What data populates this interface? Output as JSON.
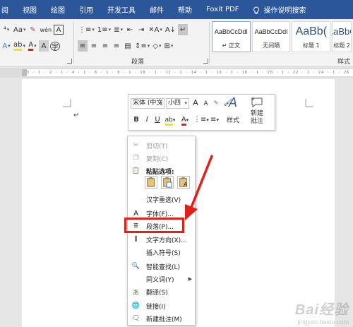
{
  "ribbon_tabs": [
    "阅",
    "视图",
    "绘图",
    "引用",
    "开发工具",
    "邮件",
    "帮助",
    "Foxit PDF"
  ],
  "tell_me": "操作说明搜索",
  "groups": {
    "paragraph": "段落",
    "styles": "样式"
  },
  "styles": [
    {
      "preview": "AaBbCcDdI",
      "name": "↵ 正文"
    },
    {
      "preview": "AaBbCcDdI",
      "name": "无间隔"
    },
    {
      "preview": "AaBb(",
      "name": "标题 1"
    },
    {
      "preview": "AaBbC",
      "name": "标题 2"
    }
  ],
  "font_row": {
    "aa_label": "Aa",
    "wen_label": "wén",
    "a_box": "A"
  },
  "ruler": {
    "numbers": "3 · 1 · 2 · 1 · 4 · 1 · 6 · 1 · 8 · 1 · 10 · 1 · 12 · 1 · 14 · 1 · 16 · 1 · 18 · 1 · 20 · 1 · 22 · 1 · 24 · 1 · 26 · 1 · 28 · 1 · 30 · 1 · 32 · 1 · 34 · 1 · 36 · 1 · 38 · 1 · 40 · 1 · 42"
  },
  "cursor_mark": "↵",
  "mini_toolbar": {
    "font_name": "宋体 (中文",
    "font_size": "小四",
    "grow": "A",
    "shrink": "A",
    "bold": "B",
    "italic": "I",
    "underline": "U",
    "styles_label": "样式",
    "new_comment_line1": "新建",
    "new_comment_line2": "批注"
  },
  "context_menu": {
    "cut": "剪切(T)",
    "copy": "复制(C)",
    "paste_options": "粘贴选项:",
    "reconvert": "汉字重选(V)",
    "font": "字体(F)...",
    "paragraph": "段落(P)...",
    "text_direction": "文字方向(X)...",
    "insert_symbol": "插入符号(S)",
    "smart_lookup": "智能查找(L)",
    "synonyms": "同义词(Y)",
    "translate": "翻译(S)",
    "link": "链接(I)",
    "new_comment": "新建批注(M)"
  },
  "colors": {
    "ribbon_tab_bg": "#2b579a",
    "highlight": "#e0201b",
    "font_red": "#e0201b",
    "highlight_yellow": "#f6e21a"
  },
  "watermark": {
    "brand": "Bai经验",
    "sub": "jingyan.baidu.com"
  }
}
